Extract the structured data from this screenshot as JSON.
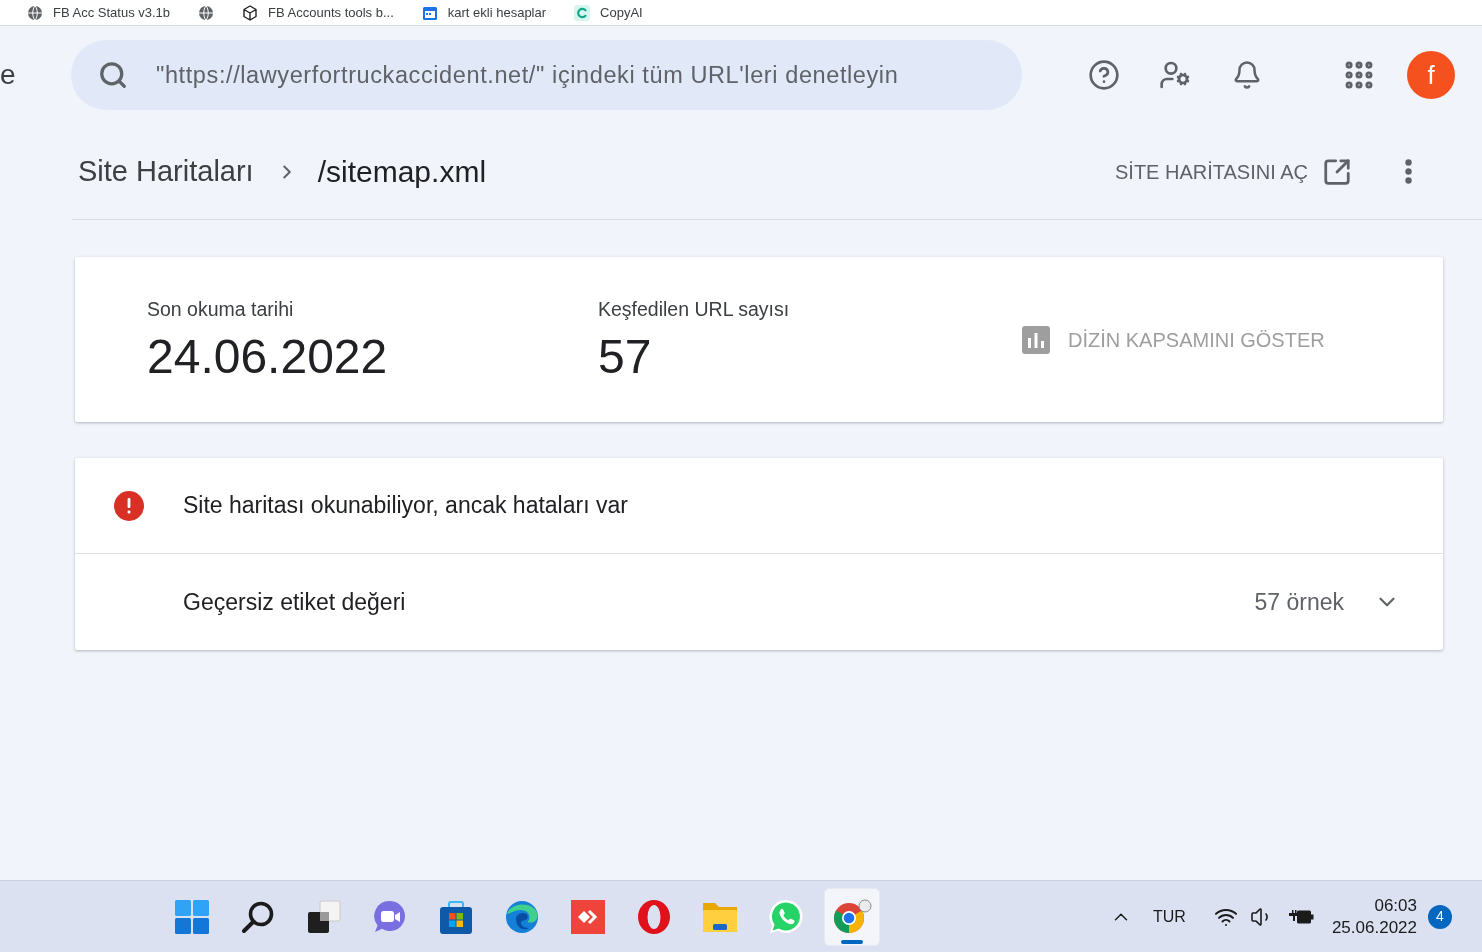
{
  "bookmarks": [
    {
      "kind": "globe",
      "label": "FB Acc Status v3.1b"
    },
    {
      "kind": "globe"
    },
    {
      "kind": "cube",
      "label": "FB Accounts tools b..."
    },
    {
      "kind": "calendar",
      "label": "kart ekli hesaplar"
    },
    {
      "kind": "logo",
      "label": "CopyAI"
    }
  ],
  "side_panel_fragment": "e",
  "search": {
    "placeholder": "\"https://lawyerfortruckaccident.net/\" içindeki tüm URL'leri denetleyin"
  },
  "avatar": {
    "initial": "f"
  },
  "breadcrumb": [
    {
      "label": "Site Haritaları",
      "current": false
    },
    {
      "label": "/sitemap.xml",
      "current": true
    }
  ],
  "open_sitemap": {
    "label": "SİTE HARİTASINI AÇ"
  },
  "summary": {
    "stats": [
      {
        "label": "Son okuma tarihi",
        "value": "24.06.2022"
      },
      {
        "label": "Keşfedilen URL sayısı",
        "value": "57"
      }
    ],
    "coverage_button": {
      "label": "DİZİN KAPSAMINI GÖSTER",
      "disabled": true
    }
  },
  "status": {
    "kind": "error",
    "message": "Site haritası okunabiliyor, ancak hataları var",
    "issues": [
      {
        "name": "Geçersiz etiket değeri",
        "count": "57 örnek",
        "expanded": false
      }
    ]
  },
  "taskbar": {
    "apps": [
      {
        "kind": "start",
        "active": false
      },
      {
        "kind": "search",
        "active": false
      },
      {
        "kind": "taskview",
        "active": false
      },
      {
        "kind": "chat",
        "active": false
      },
      {
        "kind": "store",
        "active": false
      },
      {
        "kind": "edge",
        "active": false
      },
      {
        "kind": "remote",
        "active": false
      },
      {
        "kind": "opera",
        "active": false
      },
      {
        "kind": "folder",
        "active": false
      },
      {
        "kind": "whatsapp",
        "active": false
      },
      {
        "kind": "chrome",
        "active": true
      }
    ],
    "tray": {
      "language": "TUR",
      "time": "06:03",
      "date": "25.06.2022",
      "notifications": "4"
    }
  }
}
